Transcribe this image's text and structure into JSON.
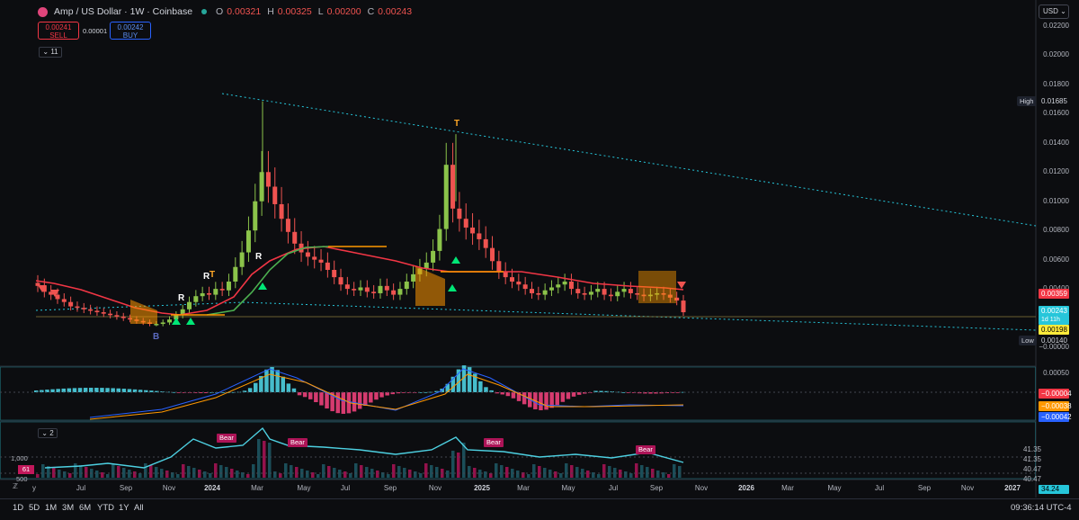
{
  "header": {
    "symbol_title": "Amp / US Dollar · 1W · Coinbase",
    "ohlc": [
      {
        "k": "O",
        "v": "0.00321"
      },
      {
        "k": "H",
        "v": "0.00325"
      },
      {
        "k": "L",
        "v": "0.00200"
      },
      {
        "k": "C",
        "v": "0.00243"
      }
    ],
    "sell_price": "0.00241",
    "sell_label": "SELL",
    "spread": "0.00001",
    "buy_price": "0.00242",
    "buy_label": "BUY",
    "indicators_count": "11",
    "currency": "USD"
  },
  "price_axis": {
    "ticks": [
      "0.02200",
      "0.02000",
      "0.01800",
      "0.01600",
      "0.01400",
      "0.01200",
      "0.01000",
      "0.00800",
      "0.00600",
      "0.00400",
      "0.00200",
      "−0.00000"
    ],
    "high_label": "High",
    "high_value": "0.01685",
    "low_label": "Low",
    "low_value": "0.00140",
    "tags": {
      "ma_red": "0.00359",
      "last_price": "0.00243",
      "countdown": "1d 11h",
      "ma_yellow": "0.00198"
    }
  },
  "macd_axis": {
    "top": "0.00050",
    "tags": [
      "−0.00004",
      "−0.00038",
      "−0.00042"
    ]
  },
  "volume_pane": {
    "collapse_label": "2",
    "left_ticks": [
      "1,000",
      "500"
    ],
    "left_value": "61",
    "right_ticks": [
      "41.35",
      "41.35",
      "40.47",
      "40.47"
    ],
    "right_value": "34.24",
    "bear_labels": [
      "Bear",
      "Bear",
      "Bear",
      "Bear"
    ]
  },
  "time_axis": {
    "labels": [
      {
        "t": "y",
        "bold": false
      },
      {
        "t": "Jul",
        "bold": false
      },
      {
        "t": "Sep",
        "bold": false
      },
      {
        "t": "Nov",
        "bold": false
      },
      {
        "t": "2024",
        "bold": true
      },
      {
        "t": "Mar",
        "bold": false
      },
      {
        "t": "May",
        "bold": false
      },
      {
        "t": "Jul",
        "bold": false
      },
      {
        "t": "Sep",
        "bold": false
      },
      {
        "t": "Nov",
        "bold": false
      },
      {
        "t": "2025",
        "bold": true
      },
      {
        "t": "Mar",
        "bold": false
      },
      {
        "t": "May",
        "bold": false
      },
      {
        "t": "Jul",
        "bold": false
      },
      {
        "t": "Sep",
        "bold": false
      },
      {
        "t": "Nov",
        "bold": false
      },
      {
        "t": "2026",
        "bold": true
      },
      {
        "t": "Mar",
        "bold": false
      },
      {
        "t": "May",
        "bold": false
      },
      {
        "t": "Jul",
        "bold": false
      },
      {
        "t": "Sep",
        "bold": false
      },
      {
        "t": "Nov",
        "bold": false
      },
      {
        "t": "2027",
        "bold": true
      }
    ]
  },
  "timeframes": [
    "1D",
    "5D",
    "1M",
    "3M",
    "6M",
    "YTD",
    "1Y",
    "All"
  ],
  "clock": "09:36:14 UTC-4",
  "markers": {
    "r": "R",
    "t": "T",
    "b": "B"
  },
  "colors": {
    "bg": "#0c0d10",
    "up": "#8bc34a",
    "down": "#ef5350",
    "ma_red": "#f23645",
    "ma_orange": "#ff9800",
    "ma_green": "#4caf50",
    "trend": "#26c6da",
    "macd_pos": "#4dd0e1",
    "macd_neg": "#ec407a",
    "rsi": "#4dd0e1"
  },
  "chart_data": {
    "type": "candlestick",
    "price_series": [
      0.0042,
      0.0038,
      0.0036,
      0.0033,
      0.0031,
      0.0028,
      0.0027,
      0.0026,
      0.0025,
      0.0024,
      0.0023,
      0.0022,
      0.0021,
      0.002,
      0.0019,
      0.0018,
      0.0017,
      0.0016,
      0.0016,
      0.0017,
      0.0019,
      0.0022,
      0.0026,
      0.0031,
      0.0035,
      0.0037,
      0.0036,
      0.004,
      0.0039,
      0.0045,
      0.0055,
      0.0065,
      0.008,
      0.01,
      0.012,
      0.011,
      0.0098,
      0.0088,
      0.0079,
      0.0071,
      0.0065,
      0.0062,
      0.006,
      0.0058,
      0.0053,
      0.0048,
      0.0043,
      0.004,
      0.0039,
      0.0041,
      0.0038,
      0.0037,
      0.0042,
      0.0039,
      0.0036,
      0.004,
      0.0045,
      0.005,
      0.0054,
      0.0058,
      0.0066,
      0.0081,
      0.0125,
      0.0095,
      0.0088,
      0.0082,
      0.0078,
      0.0074,
      0.0068,
      0.0059,
      0.0052,
      0.0048,
      0.0045,
      0.0043,
      0.004,
      0.0037,
      0.0036,
      0.0039,
      0.0041,
      0.0043,
      0.0045,
      0.004,
      0.0037,
      0.0036,
      0.0038,
      0.004,
      0.0036,
      0.0035,
      0.0038,
      0.004,
      0.0037,
      0.0036,
      0.0035,
      0.0036,
      0.0037,
      0.0036,
      0.0034,
      0.0032,
      0.0024
    ],
    "high": 0.01685,
    "low": 0.0014,
    "ylim": [
      0.0,
      0.0225
    ]
  }
}
